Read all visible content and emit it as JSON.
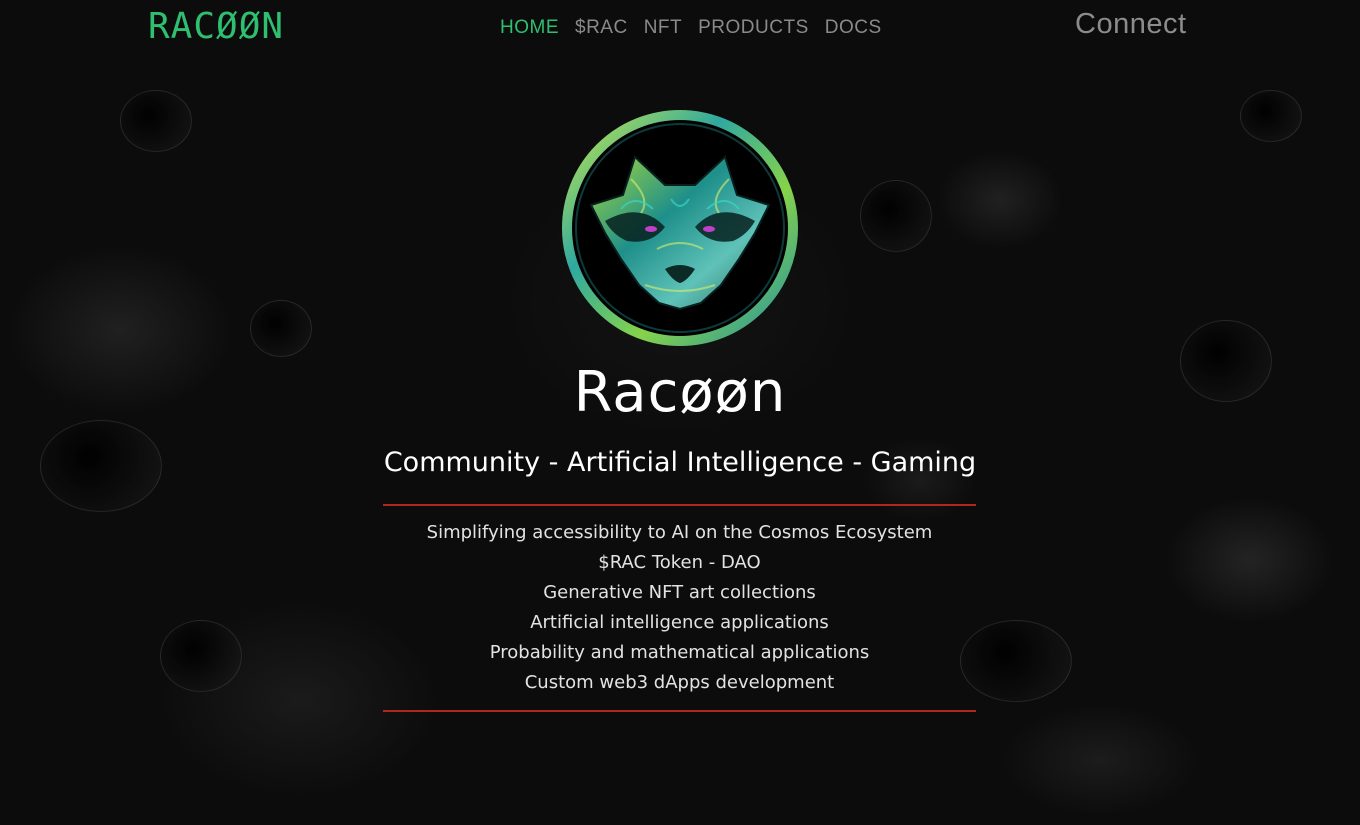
{
  "brand": {
    "logo_text": "RACØØN",
    "accent_color": "#2fbf71"
  },
  "nav": {
    "items": [
      {
        "label": "HOME",
        "active": true
      },
      {
        "label": "$RAC",
        "active": false
      },
      {
        "label": "NFT",
        "active": false
      },
      {
        "label": "PRODUCTS",
        "active": false
      },
      {
        "label": "DOCS",
        "active": false
      }
    ],
    "connect_label": "Connect"
  },
  "hero": {
    "emblem_icon": "raccoon-head-emblem-icon",
    "title": "Racøøn",
    "subtitle": "Community - Artificial Intelligence - Gaming",
    "divider_color": "#b3261e",
    "features": [
      "Simplifying accessibility to AI on the Cosmos Ecosystem",
      "$RAC Token - DAO",
      "Generative NFT art collections",
      "Artificial intelligence applications",
      "Probability and mathematical applications",
      "Custom web3 dApps development"
    ]
  }
}
